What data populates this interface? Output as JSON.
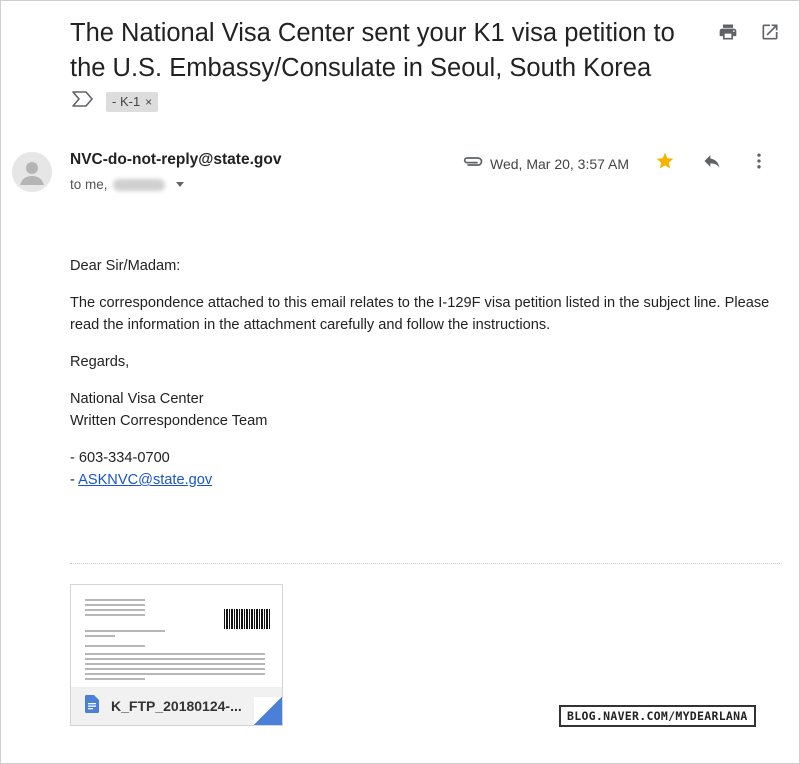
{
  "email": {
    "subject": "The National Visa Center sent your K1 visa petition to the U.S. Embassy/Consulate in Seoul, South Korea",
    "label": "- K-1",
    "label_remove": "×",
    "sender": "NVC-do-not-reply@state.gov",
    "to_prefix": "to me,",
    "date": "Wed, Mar 20, 3:57 AM",
    "starred": true,
    "body": {
      "greeting": "Dear Sir/Madam:",
      "para1": "The correspondence attached to this email relates to the I-129F visa petition listed in the subject line. Please read the information in the attachment carefully and follow the instructions.",
      "regards": "Regards,",
      "sig_line1": "National Visa Center",
      "sig_line2": "Written Correspondence Team",
      "phone": "- 603-334-0700",
      "email_prefix": "- ",
      "email_link": "ASKNVC@state.gov"
    },
    "attachment": {
      "name": "K_FTP_20180124-..."
    }
  },
  "watermark": "BLOG.NAVER.COM/MYDEARLANA",
  "colors": {
    "star": "#f4b400",
    "link": "#1a55c8",
    "doc_icon": "#4a80d8"
  },
  "icons": {
    "print": "print-icon",
    "open_new_window": "open-in-new-window-icon",
    "importance": "importance-marker-icon",
    "attachment": "paperclip-icon",
    "star": "star-icon",
    "reply": "reply-icon",
    "more": "more-vertical-icon"
  }
}
